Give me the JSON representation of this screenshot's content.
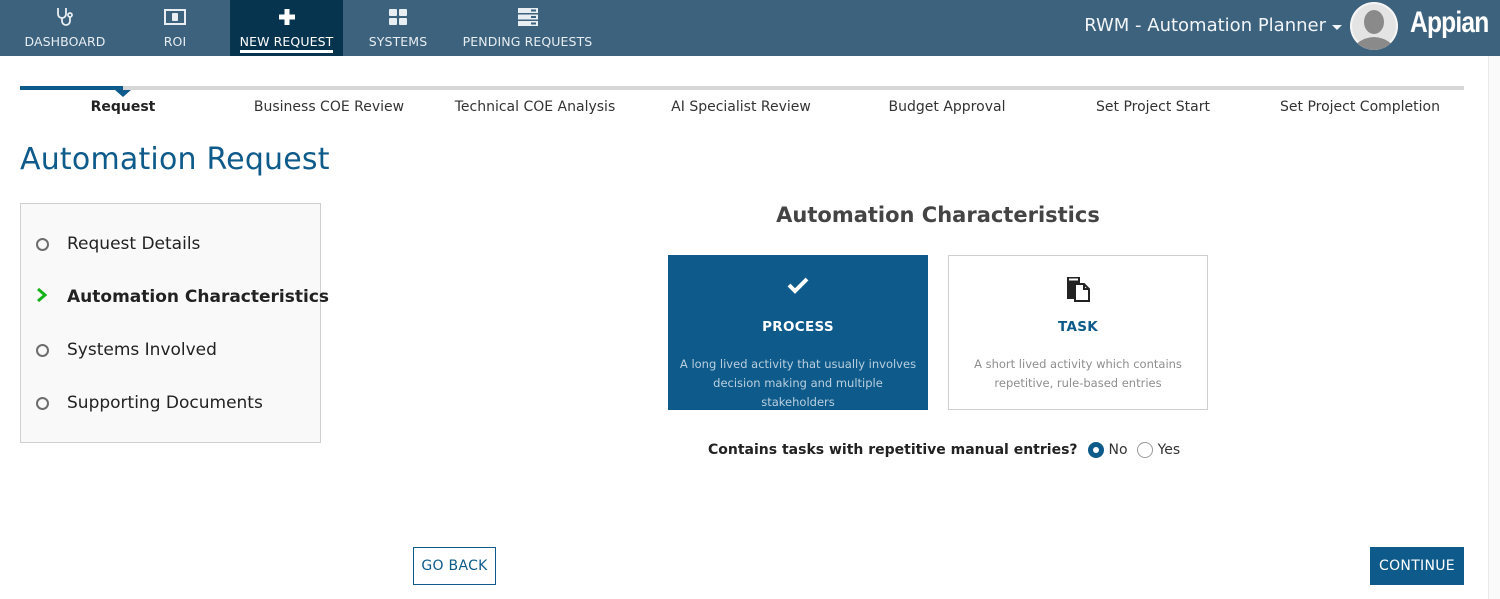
{
  "nav": {
    "items": [
      {
        "label": "DASHBOARD",
        "icon": "stethoscope-icon",
        "active": false
      },
      {
        "label": "ROI",
        "icon": "money-icon",
        "active": false
      },
      {
        "label": "NEW REQUEST",
        "icon": "plus-icon",
        "active": true
      },
      {
        "label": "SYSTEMS",
        "icon": "grid-icon",
        "active": false
      },
      {
        "label": "PENDING REQUESTS",
        "icon": "server-list-icon",
        "active": false
      }
    ],
    "app_name": "RWM - Automation Planner",
    "logo": "Appian"
  },
  "steps": {
    "items": [
      "Request",
      "Business COE Review",
      "Technical COE Analysis",
      "AI Specialist Review",
      "Budget Approval",
      "Set Project Start",
      "Set Project Completion"
    ],
    "current_index": 0
  },
  "page": {
    "title": "Automation Request"
  },
  "sections": {
    "items": [
      {
        "label": "Request Details",
        "state": "pending"
      },
      {
        "label": "Automation Characteristics",
        "state": "current"
      },
      {
        "label": "Systems Involved",
        "state": "pending"
      },
      {
        "label": "Supporting Documents",
        "state": "pending"
      }
    ]
  },
  "form": {
    "section_title": "Automation Characteristics",
    "cards": [
      {
        "title": "PROCESS",
        "description": "A long lived activity that usually involves decision making and multiple stakeholders",
        "icon": "checkmark-icon",
        "selected": true
      },
      {
        "title": "TASK",
        "description": "A short lived activity which contains repetitive, rule-based entries",
        "icon": "copy-document-icon",
        "selected": false
      }
    ],
    "question": {
      "label": "Contains tasks with repetitive manual entries?",
      "options": [
        "No",
        "Yes"
      ],
      "selected": "No"
    }
  },
  "buttons": {
    "back": "GO BACK",
    "continue": "CONTINUE"
  },
  "colors": {
    "topbar": "#3c627d",
    "topbar_active": "#06344f",
    "accent": "#0e5a8a",
    "current_section_chevron": "#15b21a"
  }
}
